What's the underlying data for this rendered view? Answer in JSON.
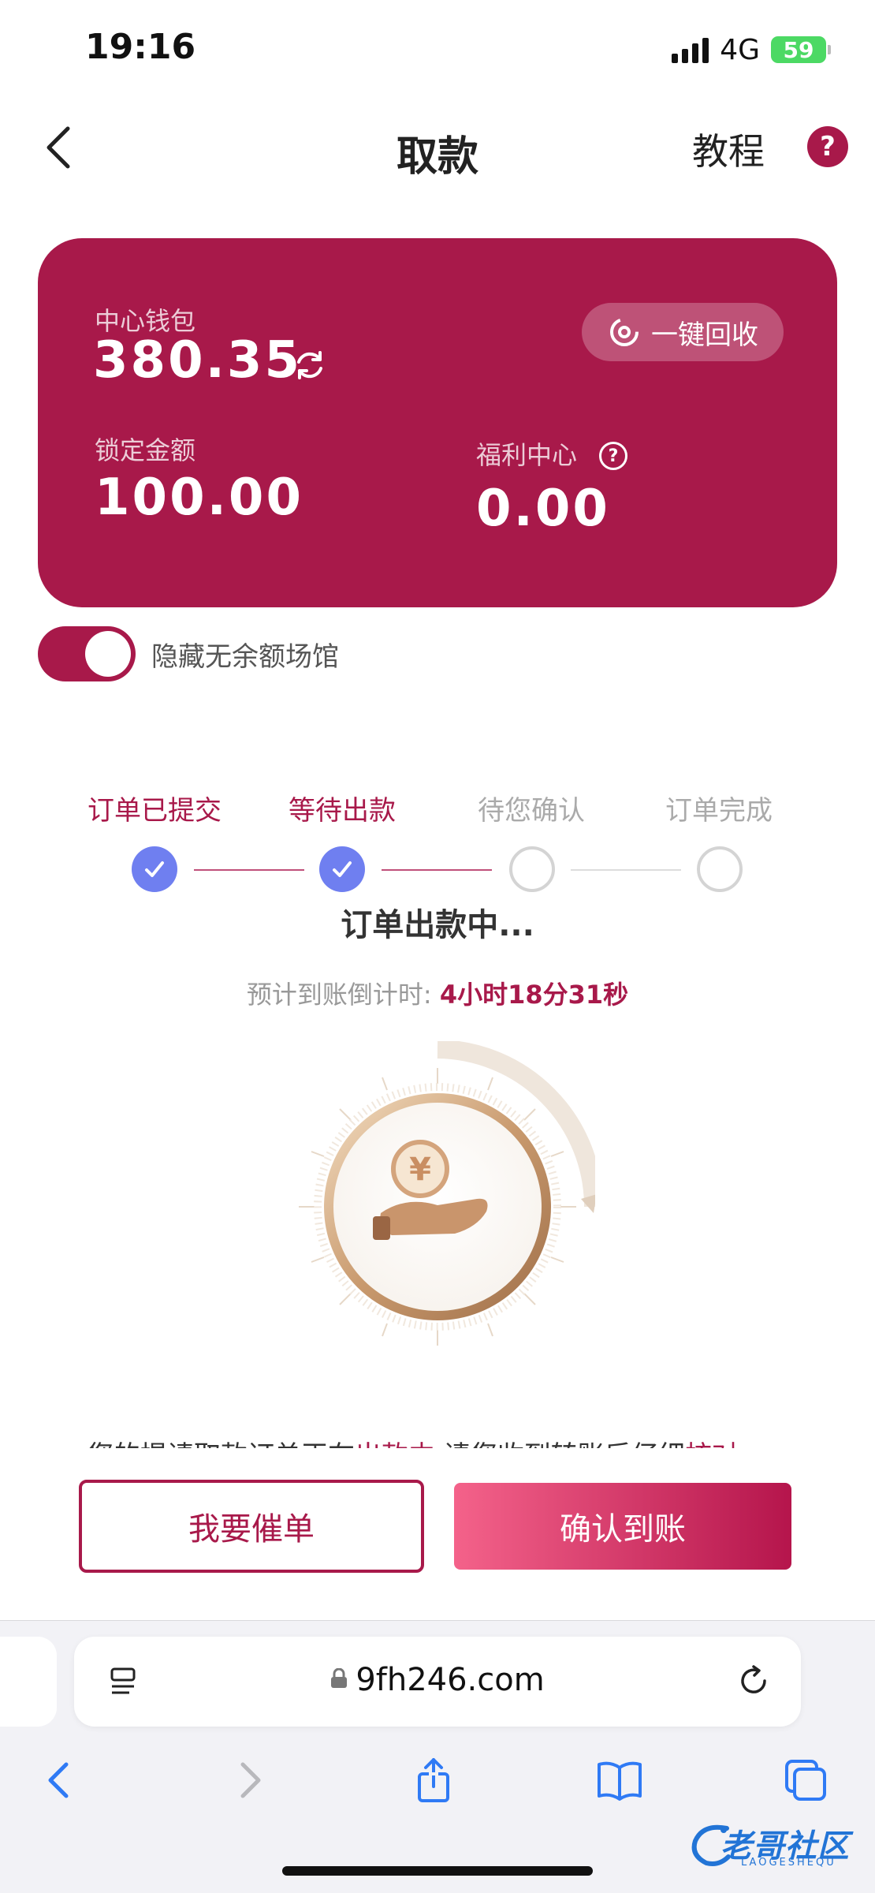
{
  "status_bar": {
    "time": "19:16",
    "network": "4G",
    "battery": "59"
  },
  "nav": {
    "title": "取款",
    "tutorial": "教程",
    "help": "?"
  },
  "wallet": {
    "center_label": "中心钱包",
    "center_amount": "380.35",
    "recycle_label": "一键回收",
    "locked_label": "锁定金额",
    "locked_amount": "100.00",
    "welfare_label": "福利中心",
    "welfare_help": "?",
    "welfare_amount": "0.00"
  },
  "toggle": {
    "label": "隐藏无余额场馆",
    "on": true
  },
  "steps": [
    {
      "label": "订单已提交",
      "done": true
    },
    {
      "label": "等待出款",
      "done": true
    },
    {
      "label": "待您确认",
      "done": false
    },
    {
      "label": "订单完成",
      "done": false
    }
  ],
  "order": {
    "status": "订单出款中...",
    "countdown_label": "预计到账倒计时:",
    "countdown_value": "4小时18分31秒",
    "partial_notice_a": "您的提请取款订单正在",
    "partial_notice_red": "出款中",
    "partial_notice_b": ",请您收到转账后仔细",
    "partial_notice_red2": "核对"
  },
  "actions": {
    "urge": "我要催单",
    "confirm": "确认到账"
  },
  "browser": {
    "url": "9fh246.com"
  },
  "watermark": {
    "text": "老哥社区",
    "sub": "LAOGESHEQU"
  },
  "colors": {
    "brand": "#a8194a",
    "step_check": "#6f7ff0"
  }
}
